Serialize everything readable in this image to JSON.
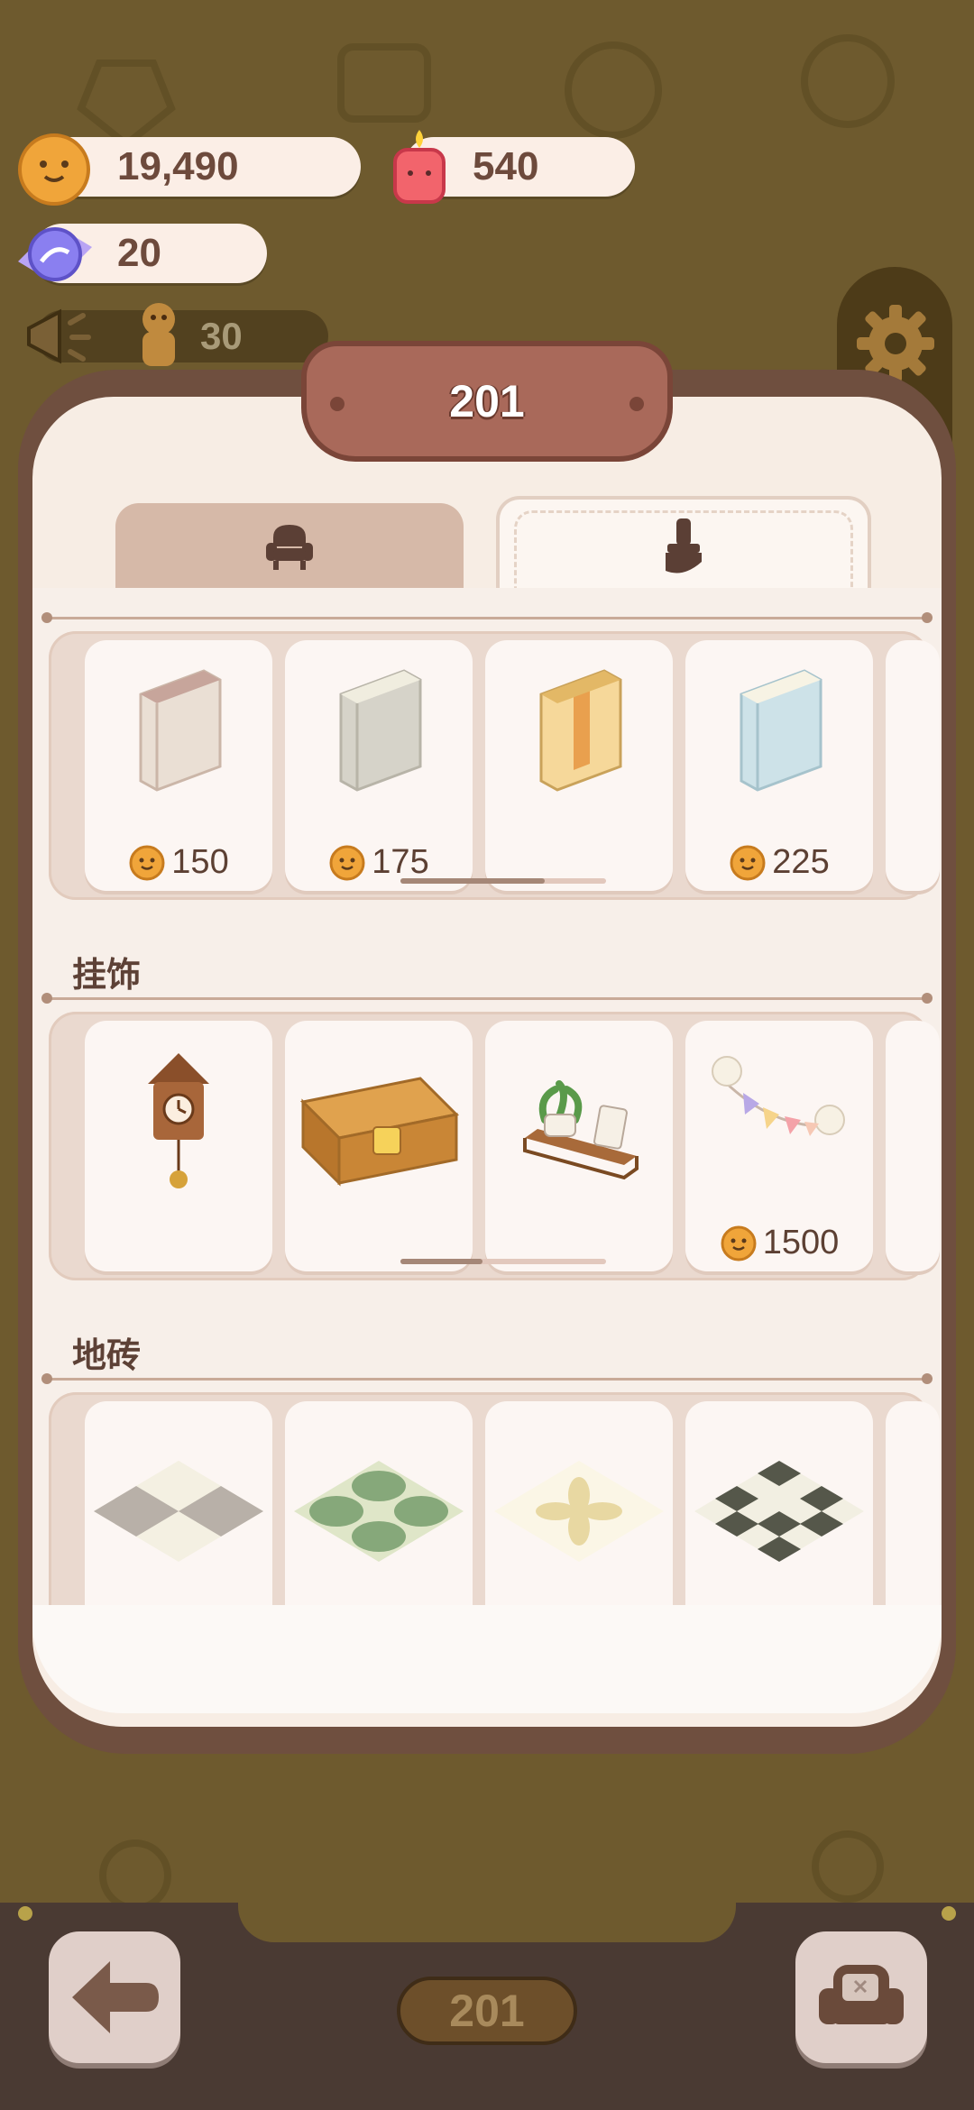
{
  "currencies": {
    "coins": "19,490",
    "gems": "540",
    "candy": "20",
    "tickets": "30"
  },
  "room": {
    "number": "201",
    "badge": "201"
  },
  "tabs": [
    {
      "name": "furniture",
      "icon": "armchair-icon",
      "active": false
    },
    {
      "name": "decor",
      "icon": "paint-brush-icon",
      "active": true
    }
  ],
  "sections": {
    "walls": {
      "items": [
        {
          "name": "white-brick-wall",
          "price": "150"
        },
        {
          "name": "grey-wall",
          "price": "175"
        },
        {
          "name": "striped-wall",
          "price": ""
        },
        {
          "name": "blue-wall",
          "price": "225"
        }
      ],
      "scroll_progress": 0.7
    },
    "hangings": {
      "title": "挂饰",
      "items": [
        {
          "name": "cuckoo-clock",
          "price": ""
        },
        {
          "name": "wall-shelf",
          "price": ""
        },
        {
          "name": "plant-shelf",
          "price": ""
        },
        {
          "name": "bunting-garland",
          "price": "1500"
        }
      ],
      "scroll_progress": 0.4
    },
    "floor_tiles": {
      "title": "地砖",
      "items": [
        {
          "name": "checker-tile"
        },
        {
          "name": "green-circle-tile"
        },
        {
          "name": "cream-flower-tile"
        },
        {
          "name": "black-white-pattern-tile"
        }
      ]
    }
  },
  "colors": {
    "background": "#6e5a2e",
    "panel_border": "#6f4f3f",
    "panel": "#f7ede4",
    "title_plate": "#a9695a"
  }
}
